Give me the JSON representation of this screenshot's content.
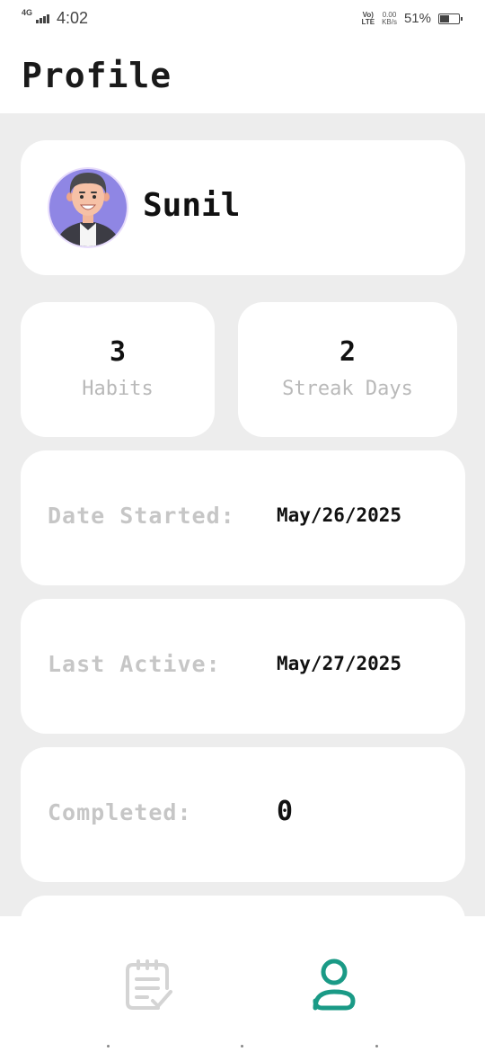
{
  "status_bar": {
    "network": "4G",
    "time": "4:02",
    "volte_line1": "Vo)",
    "volte_line2": "LTE",
    "speed_value": "0.00",
    "speed_unit": "KB/s",
    "battery_percent": "51%",
    "battery_level": 0.51
  },
  "header": {
    "title": "Profile"
  },
  "profile": {
    "name": "Sunil",
    "avatar_icon": "user-avatar-icon"
  },
  "stats": [
    {
      "value": "3",
      "label": "Habits"
    },
    {
      "value": "2",
      "label": "Streak Days"
    }
  ],
  "info": [
    {
      "label": "Date Started:",
      "value": "May/26/2025"
    },
    {
      "label": "Last Active:",
      "value": "May/27/2025"
    },
    {
      "label": "Completed:",
      "value": "0"
    }
  ],
  "bottom_nav": {
    "items": [
      {
        "icon": "habits-checklist-icon",
        "active": false
      },
      {
        "icon": "profile-person-icon",
        "active": true
      }
    ],
    "accent_color": "#1a9a86",
    "inactive_color": "#d4d4d4"
  }
}
